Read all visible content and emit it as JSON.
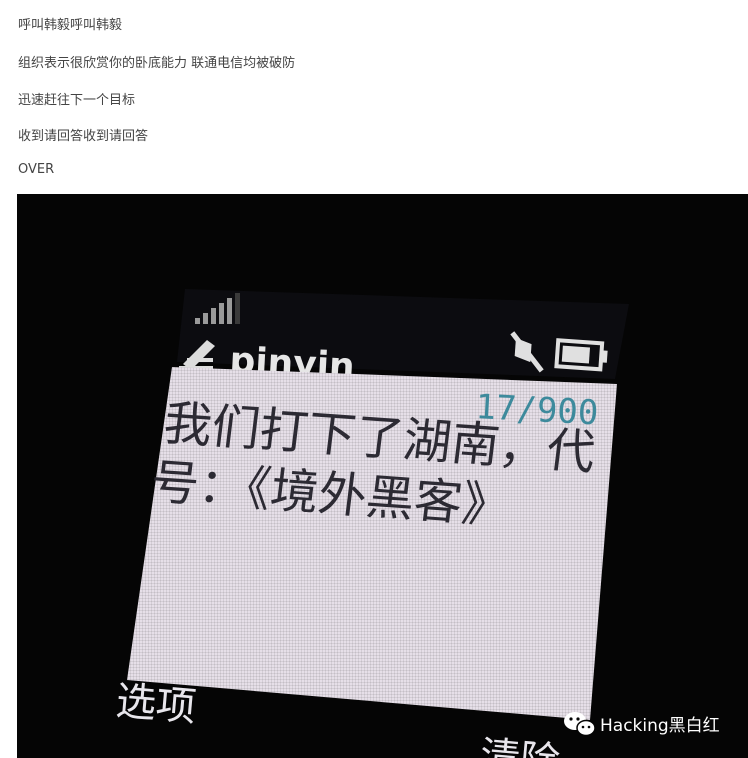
{
  "post": {
    "lines": [
      "呼叫韩毅呼叫韩毅",
      "组织表示很欣赏你的卧底能力 联通电信均被破防",
      "迅速赶往下一个目标",
      "收到请回答收到请回答",
      "OVER"
    ]
  },
  "phone_screen": {
    "input_mode": "pinyin",
    "char_count": "17/900",
    "message_line1": "我们打下了湖南，代",
    "message_line2": "号：《境外黑客》",
    "softkey_left": "选项",
    "softkey_right": "清除",
    "signal_bars_level": 0.8,
    "battery_level": 0.8
  },
  "watermark": {
    "text": "Hacking黑白红",
    "icon": "wechat-icon"
  },
  "colors": {
    "screen_bg": "#e6dfe8",
    "screen_text": "#2c2a33",
    "counter_text": "#3d8a9c",
    "photo_bg": "#050505",
    "softkey_text": "#e8e6ec"
  }
}
